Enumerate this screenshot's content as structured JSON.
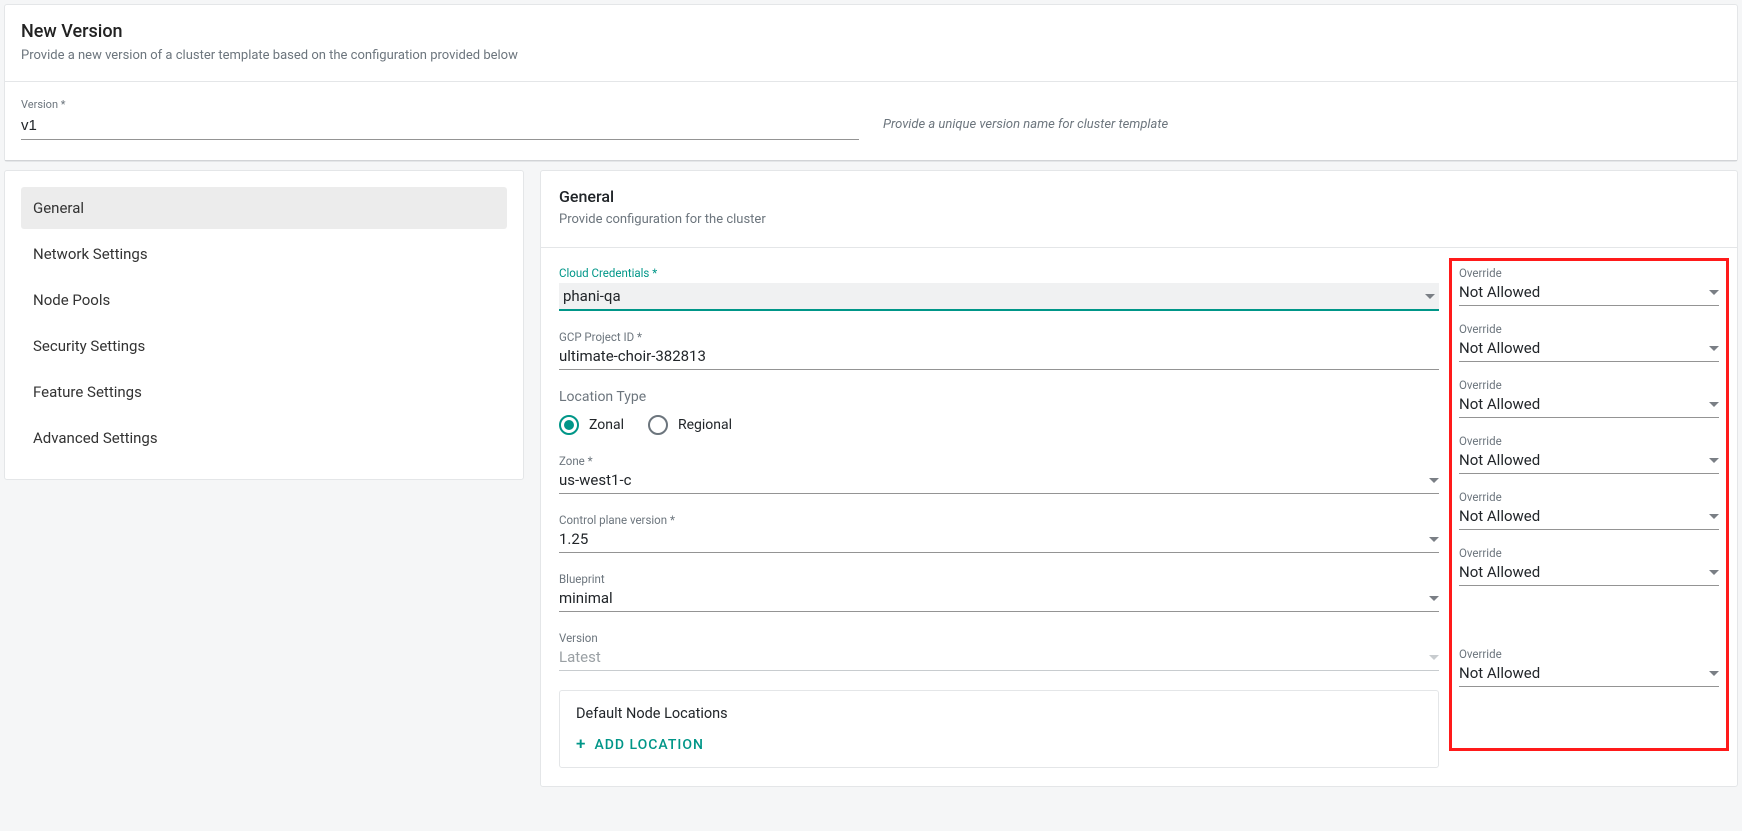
{
  "header": {
    "title": "New Version",
    "description": "Provide a new version of a cluster template based on the configuration provided below"
  },
  "version_field": {
    "label": "Version *",
    "value": "v1",
    "hint": "Provide a unique version name for cluster template"
  },
  "sidebar": {
    "items": [
      {
        "label": "General",
        "active": true
      },
      {
        "label": "Network Settings",
        "active": false
      },
      {
        "label": "Node Pools",
        "active": false
      },
      {
        "label": "Security Settings",
        "active": false
      },
      {
        "label": "Feature Settings",
        "active": false
      },
      {
        "label": "Advanced Settings",
        "active": false
      }
    ]
  },
  "panel": {
    "title": "General",
    "description": "Provide configuration for the cluster"
  },
  "form": {
    "cloud_credentials": {
      "label": "Cloud Credentials *",
      "value": "phani-qa"
    },
    "gcp_project": {
      "label": "GCP Project ID *",
      "value": "ultimate-choir-382813"
    },
    "location_type": {
      "label": "Location Type",
      "options": [
        {
          "label": "Zonal",
          "selected": true
        },
        {
          "label": "Regional",
          "selected": false
        }
      ]
    },
    "zone": {
      "label": "Zone *",
      "value": "us-west1-c"
    },
    "control_plane": {
      "label": "Control plane version *",
      "value": "1.25"
    },
    "blueprint": {
      "label": "Blueprint",
      "value": "minimal"
    },
    "blueprint_version": {
      "label": "Version",
      "value": "Latest"
    },
    "node_locations": {
      "title": "Default Node Locations",
      "add_label": "ADD  LOCATION"
    }
  },
  "overrides": {
    "label": "Override",
    "value": "Not Allowed"
  }
}
